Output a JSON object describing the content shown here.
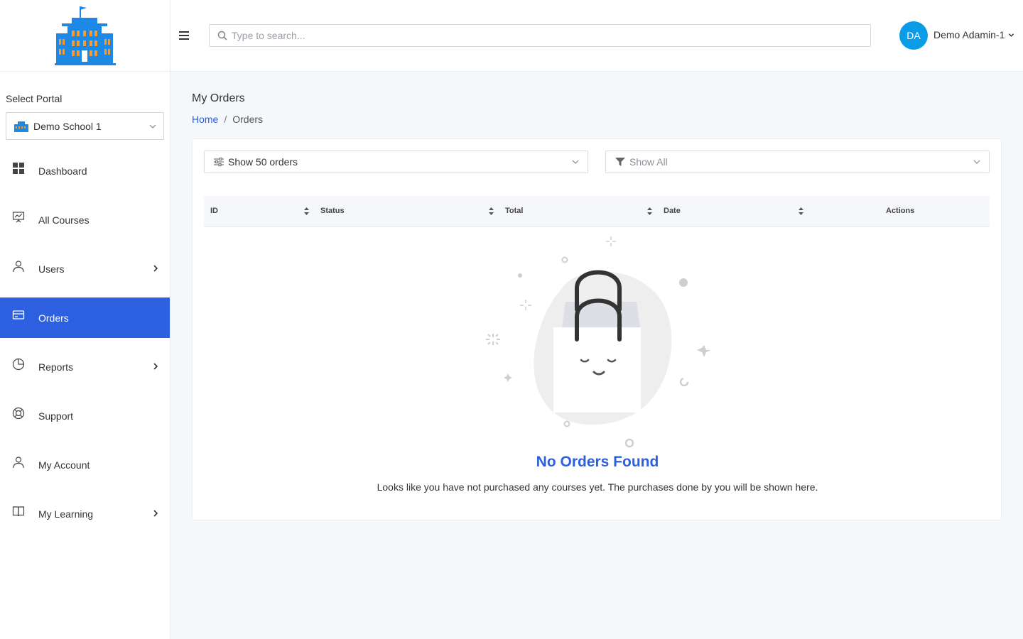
{
  "sidebar": {
    "portal_label": "Select Portal",
    "portal_value": "Demo School 1",
    "items": [
      {
        "label": "Dashboard",
        "icon": "grid-icon",
        "has_arrow": false,
        "active": false
      },
      {
        "label": "All Courses",
        "icon": "presentation-board-icon",
        "has_arrow": false,
        "active": false
      },
      {
        "label": "Users",
        "icon": "user-icon",
        "has_arrow": true,
        "active": false
      },
      {
        "label": "Orders",
        "icon": "credit-card-icon",
        "has_arrow": false,
        "active": true
      },
      {
        "label": "Reports",
        "icon": "pie-chart-icon",
        "has_arrow": true,
        "active": false
      },
      {
        "label": "Support",
        "icon": "lifebuoy-icon",
        "has_arrow": false,
        "active": false
      },
      {
        "label": "My Account",
        "icon": "user-icon",
        "has_arrow": false,
        "active": false
      },
      {
        "label": "My Learning",
        "icon": "book-icon",
        "has_arrow": true,
        "active": false
      }
    ]
  },
  "header": {
    "search_placeholder": "Type to search...",
    "avatar_initials": "DA",
    "user_name": "Demo Adamin-1"
  },
  "main": {
    "title": "My Orders",
    "breadcrumb": {
      "home": "Home",
      "separator": "/",
      "current": "Orders"
    },
    "filters": {
      "page_size": "Show 50 orders",
      "status": "Show All"
    },
    "table": {
      "columns": [
        "ID",
        "Status",
        "Total",
        "Date",
        "Actions"
      ]
    },
    "empty": {
      "title": "No Orders Found",
      "message": "Looks like you have not purchased any courses yet. The purchases done by you will be shown here."
    }
  },
  "colors": {
    "accent": "#2c60e0",
    "avatar": "#0b9ce8",
    "logo_blue": "#1e88e5",
    "logo_orange": "#f39c33"
  }
}
